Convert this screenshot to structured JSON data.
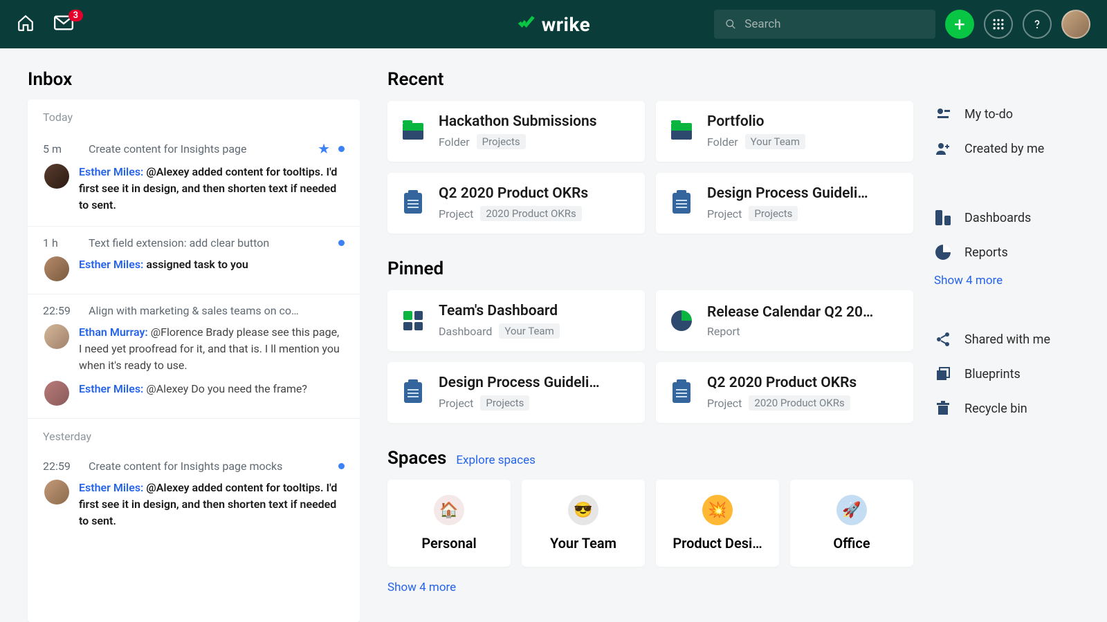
{
  "header": {
    "mail_badge": "3",
    "brand": "wrike",
    "search_placeholder": "Search"
  },
  "inbox": {
    "title": "Inbox",
    "groups": [
      {
        "label": "Today",
        "messages": [
          {
            "time": "5 m",
            "title": "Create content for Insights page",
            "starred": true,
            "unread": true,
            "avatars": [
              "em"
            ],
            "rows": [
              {
                "author": "Esther Miles:",
                "body": " @Alexey added content for tooltips. I'd first see it in design, and then shorten text if needed to sent.",
                "bold": true
              }
            ]
          },
          {
            "time": "1 h",
            "title": "Text field extension: add clear button",
            "starred": false,
            "unread": true,
            "avatars": [
              "em2"
            ],
            "rows": [
              {
                "author": "Esther Miles:",
                "body": " assigned task to you",
                "bold": true
              }
            ]
          },
          {
            "time": "22:59",
            "title": "Align with marketing & sales teams on co…",
            "starred": false,
            "unread": false,
            "avatars": [
              "eth",
              "es2"
            ],
            "rows": [
              {
                "author": "Ethan Murray:",
                "body": " @Florence Brady please see this page, I need yet proofread for it, and that is. I ll mention you when it's ready to use.",
                "bold": false
              },
              {
                "author": "Esther Miles:",
                "body": " @Alexey Do you need the frame?",
                "bold": false
              }
            ]
          }
        ]
      },
      {
        "label": "Yesterday",
        "messages": [
          {
            "time": "22:59",
            "title": "Create content for Insights page mocks",
            "starred": false,
            "unread": true,
            "avatars": [
              "em3"
            ],
            "rows": [
              {
                "author": "Esther Miles:",
                "body": " @Alexey added content for tooltips. I'd first see it in design, and then shorten text if needed to sent.",
                "bold": true
              }
            ]
          }
        ]
      }
    ]
  },
  "recent": {
    "title": "Recent",
    "cards": [
      {
        "icon": "folder",
        "title": "Hackathon Submissions",
        "type": "Folder",
        "chip": "Projects"
      },
      {
        "icon": "folder",
        "title": "Portfolio",
        "type": "Folder",
        "chip": "Your Team"
      },
      {
        "icon": "project",
        "title": "Q2 2020 Product OKRs",
        "type": "Project",
        "chip": "2020 Product OKRs"
      },
      {
        "icon": "project",
        "title": "Design Process Guideli…",
        "type": "Project",
        "chip": "Projects"
      }
    ]
  },
  "pinned": {
    "title": "Pinned",
    "cards": [
      {
        "icon": "dashboard",
        "title": "Team's Dashboard",
        "type": "Dashboard",
        "chip": "Your Team"
      },
      {
        "icon": "report",
        "title": "Release Calendar Q2 20…",
        "type": "Report",
        "chip": ""
      },
      {
        "icon": "project",
        "title": "Design Process Guideli…",
        "type": "Project",
        "chip": "Projects"
      },
      {
        "icon": "project",
        "title": "Q2 2020 Product OKRs",
        "type": "Project",
        "chip": "2020 Product OKRs"
      }
    ]
  },
  "spaces": {
    "title": "Spaces",
    "explore": "Explore spaces",
    "items": [
      {
        "emoji": "🏠",
        "name": "Personal",
        "bg": "sb1"
      },
      {
        "emoji": "😎",
        "name": "Your Team",
        "bg": "sb2"
      },
      {
        "emoji": "💥",
        "name": "Product Desi…",
        "bg": "sb3"
      },
      {
        "emoji": "🚀",
        "name": "Office",
        "bg": "sb4"
      }
    ],
    "more": "Show 4 more"
  },
  "right": {
    "group1": [
      {
        "icon": "todo",
        "label": "My to-do"
      },
      {
        "icon": "created",
        "label": "Created by me"
      }
    ],
    "group2": [
      {
        "icon": "dashboards",
        "label": "Dashboards"
      },
      {
        "icon": "reports",
        "label": "Reports"
      }
    ],
    "group2_more": "Show 4 more",
    "group3": [
      {
        "icon": "shared",
        "label": "Shared with me"
      },
      {
        "icon": "blueprints",
        "label": "Blueprints"
      },
      {
        "icon": "recycle",
        "label": "Recycle bin"
      }
    ]
  }
}
